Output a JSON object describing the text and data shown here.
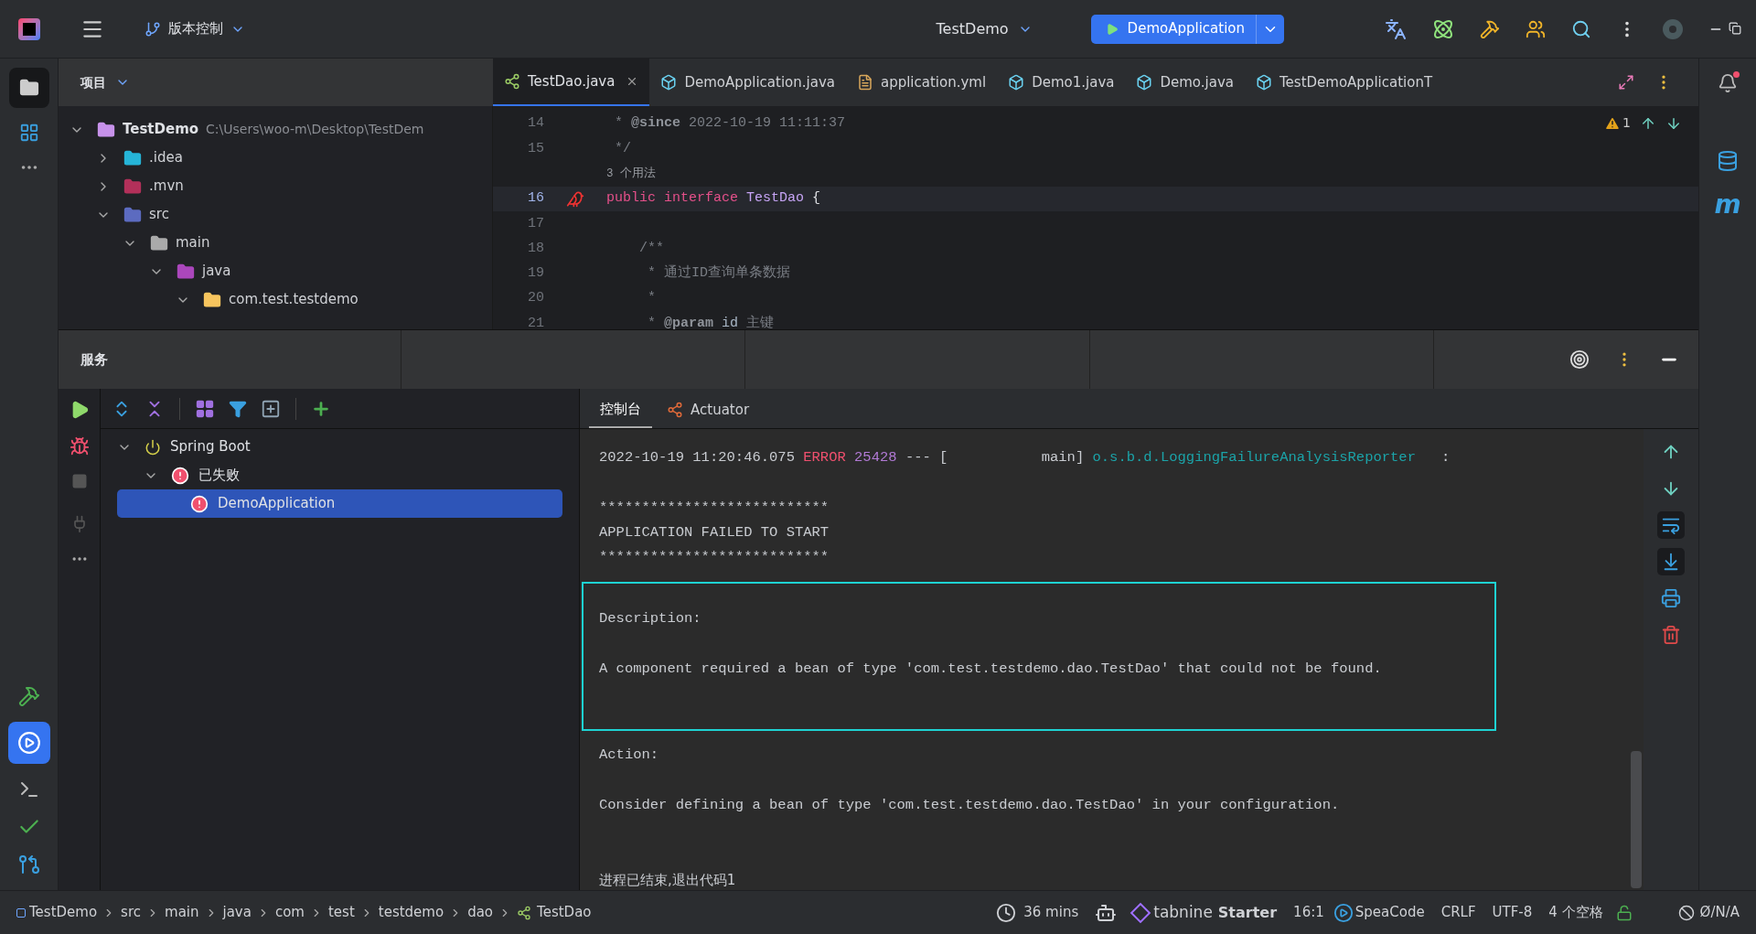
{
  "top_bar": {
    "vcs": "版本控制",
    "project": "TestDemo",
    "run_config": "DemoApplication"
  },
  "project_panel": {
    "title": "项目",
    "tree": [
      {
        "name": "TestDemo",
        "path": "C:\\Users\\woo-m\\Desktop\\TestDem",
        "kind": "project",
        "expanded": true,
        "children": [
          {
            "name": ".idea",
            "kind": "idea",
            "expanded": false
          },
          {
            "name": ".mvn",
            "kind": "mvn",
            "expanded": false
          },
          {
            "name": "src",
            "kind": "src",
            "expanded": true,
            "children": [
              {
                "name": "main",
                "kind": "plain",
                "expanded": true,
                "children": [
                  {
                    "name": "java",
                    "kind": "java",
                    "expanded": true,
                    "children": [
                      {
                        "name": "com.test.testdemo",
                        "kind": "package",
                        "expanded": true
                      }
                    ]
                  }
                ]
              }
            ]
          }
        ]
      }
    ]
  },
  "editor": {
    "tabs": [
      {
        "label": "TestDao.java",
        "kind": "interface",
        "selected": true
      },
      {
        "label": "DemoApplication.java",
        "kind": "boot",
        "selected": false
      },
      {
        "label": "application.yml",
        "kind": "yaml",
        "selected": false
      },
      {
        "label": "Demo1.java",
        "kind": "class",
        "selected": false
      },
      {
        "label": "Demo.java",
        "kind": "class",
        "selected": false
      },
      {
        "label": "TestDemoApplicationT",
        "kind": "class",
        "selected": false
      }
    ],
    "warnings": "1",
    "lines": [
      {
        "kind": "code",
        "number": "14",
        "current": false,
        "tokens": [
          {
            "kind": "comment",
            "text": " * "
          },
          {
            "kind": "tag",
            "text": "@since"
          },
          {
            "kind": "comment",
            "text": " 2022-10-19 11:11:37"
          }
        ]
      },
      {
        "kind": "code",
        "number": "15",
        "current": false,
        "tokens": [
          {
            "kind": "comment",
            "text": " */"
          }
        ]
      },
      {
        "kind": "hint",
        "text": "3 个用法"
      },
      {
        "kind": "code",
        "number": "16",
        "current": true,
        "tokens": [
          {
            "kind": "keyword",
            "text": "public interface "
          },
          {
            "kind": "type",
            "text": "TestDao"
          },
          {
            "kind": "plain",
            "text": " {"
          }
        ]
      },
      {
        "kind": "code",
        "number": "17",
        "current": false
      },
      {
        "kind": "code",
        "number": "18",
        "current": false,
        "tokens": [
          {
            "kind": "comment",
            "text": "    /**"
          }
        ]
      },
      {
        "kind": "code",
        "number": "19",
        "current": false,
        "tokens": [
          {
            "kind": "comment",
            "text": "     * 通过ID查询单条数据"
          }
        ]
      },
      {
        "kind": "code",
        "number": "20",
        "current": false,
        "tokens": [
          {
            "kind": "comment",
            "text": "     *"
          }
        ]
      },
      {
        "kind": "code",
        "number": "21",
        "current": false,
        "tokens": [
          {
            "kind": "comment",
            "text": "     * "
          },
          {
            "kind": "tag",
            "text": "@param"
          },
          {
            "kind": "param",
            "text": " id"
          },
          {
            "kind": "comment",
            "text": " 主键"
          }
        ]
      }
    ]
  },
  "right_strip": {
    "maven_label": "m"
  },
  "services": {
    "title": "服务",
    "tree": [
      {
        "name": "Spring Boot",
        "kind": "group",
        "expanded": true,
        "selected": false,
        "children": [
          {
            "name": "已失败",
            "kind": "failed",
            "expanded": true,
            "selected": false,
            "children": [
              {
                "name": "DemoApplication",
                "kind": "failed",
                "selected": true
              }
            ]
          }
        ]
      }
    ],
    "console_tabs": [
      {
        "label": "控制台",
        "kind": "text",
        "selected": true
      },
      {
        "label": "Actuator",
        "kind": "actuator",
        "selected": false
      }
    ],
    "console": {
      "sections": [
        {
          "highlighted": false,
          "paragraphs": [
            [
              [
                {
                  "kind": "plain",
                  "text": "2022-10-19 11:20:46.075 "
                },
                {
                  "kind": "error",
                  "text": "ERROR"
                },
                {
                  "kind": "pid",
                  "text": " 25428"
                },
                {
                  "kind": "plain",
                  "text": " --- [           main] "
                },
                {
                  "kind": "logger",
                  "text": "o.s.b.d.LoggingFailureAnalysisReporter"
                },
                {
                  "kind": "plain",
                  "text": "   :"
                }
              ]
            ],
            [
              [
                {
                  "kind": "plain",
                  "text": "***************************"
                }
              ],
              [
                {
                  "kind": "plain",
                  "text": "APPLICATION FAILED TO START"
                }
              ],
              [
                {
                  "kind": "plain",
                  "text": "***************************"
                }
              ]
            ]
          ]
        },
        {
          "highlighted": true,
          "paragraphs": [
            [
              [
                {
                  "kind": "plain",
                  "text": "Description:"
                }
              ]
            ],
            [
              [
                {
                  "kind": "plain",
                  "text": "A component required a bean of type 'com.test.testdemo.dao.TestDao' that could not be found."
                }
              ]
            ]
          ]
        },
        {
          "highlighted": false,
          "paragraphs": [
            [
              [
                {
                  "kind": "plain",
                  "text": "Action:"
                }
              ]
            ],
            [
              [
                {
                  "kind": "plain",
                  "text": "Consider defining a bean of type 'com.test.testdemo.dao.TestDao' in your configuration."
                }
              ]
            ]
          ]
        }
      ],
      "exit_message": "进程已结束,退出代码1"
    }
  },
  "status_bar": {
    "breadcrumbs": [
      "TestDemo",
      "src",
      "main",
      "java",
      "com",
      "test",
      "testdemo",
      "dao",
      "TestDao"
    ],
    "time": "36 mins",
    "tabnine": "tabnine",
    "tabnine_plan": "Starter",
    "position": "16:1",
    "speacode": "SpeaCode",
    "line_ending": "CRLF",
    "encoding": "UTF-8",
    "indent": "4 个空格",
    "inspection": "Ø/N/A"
  }
}
